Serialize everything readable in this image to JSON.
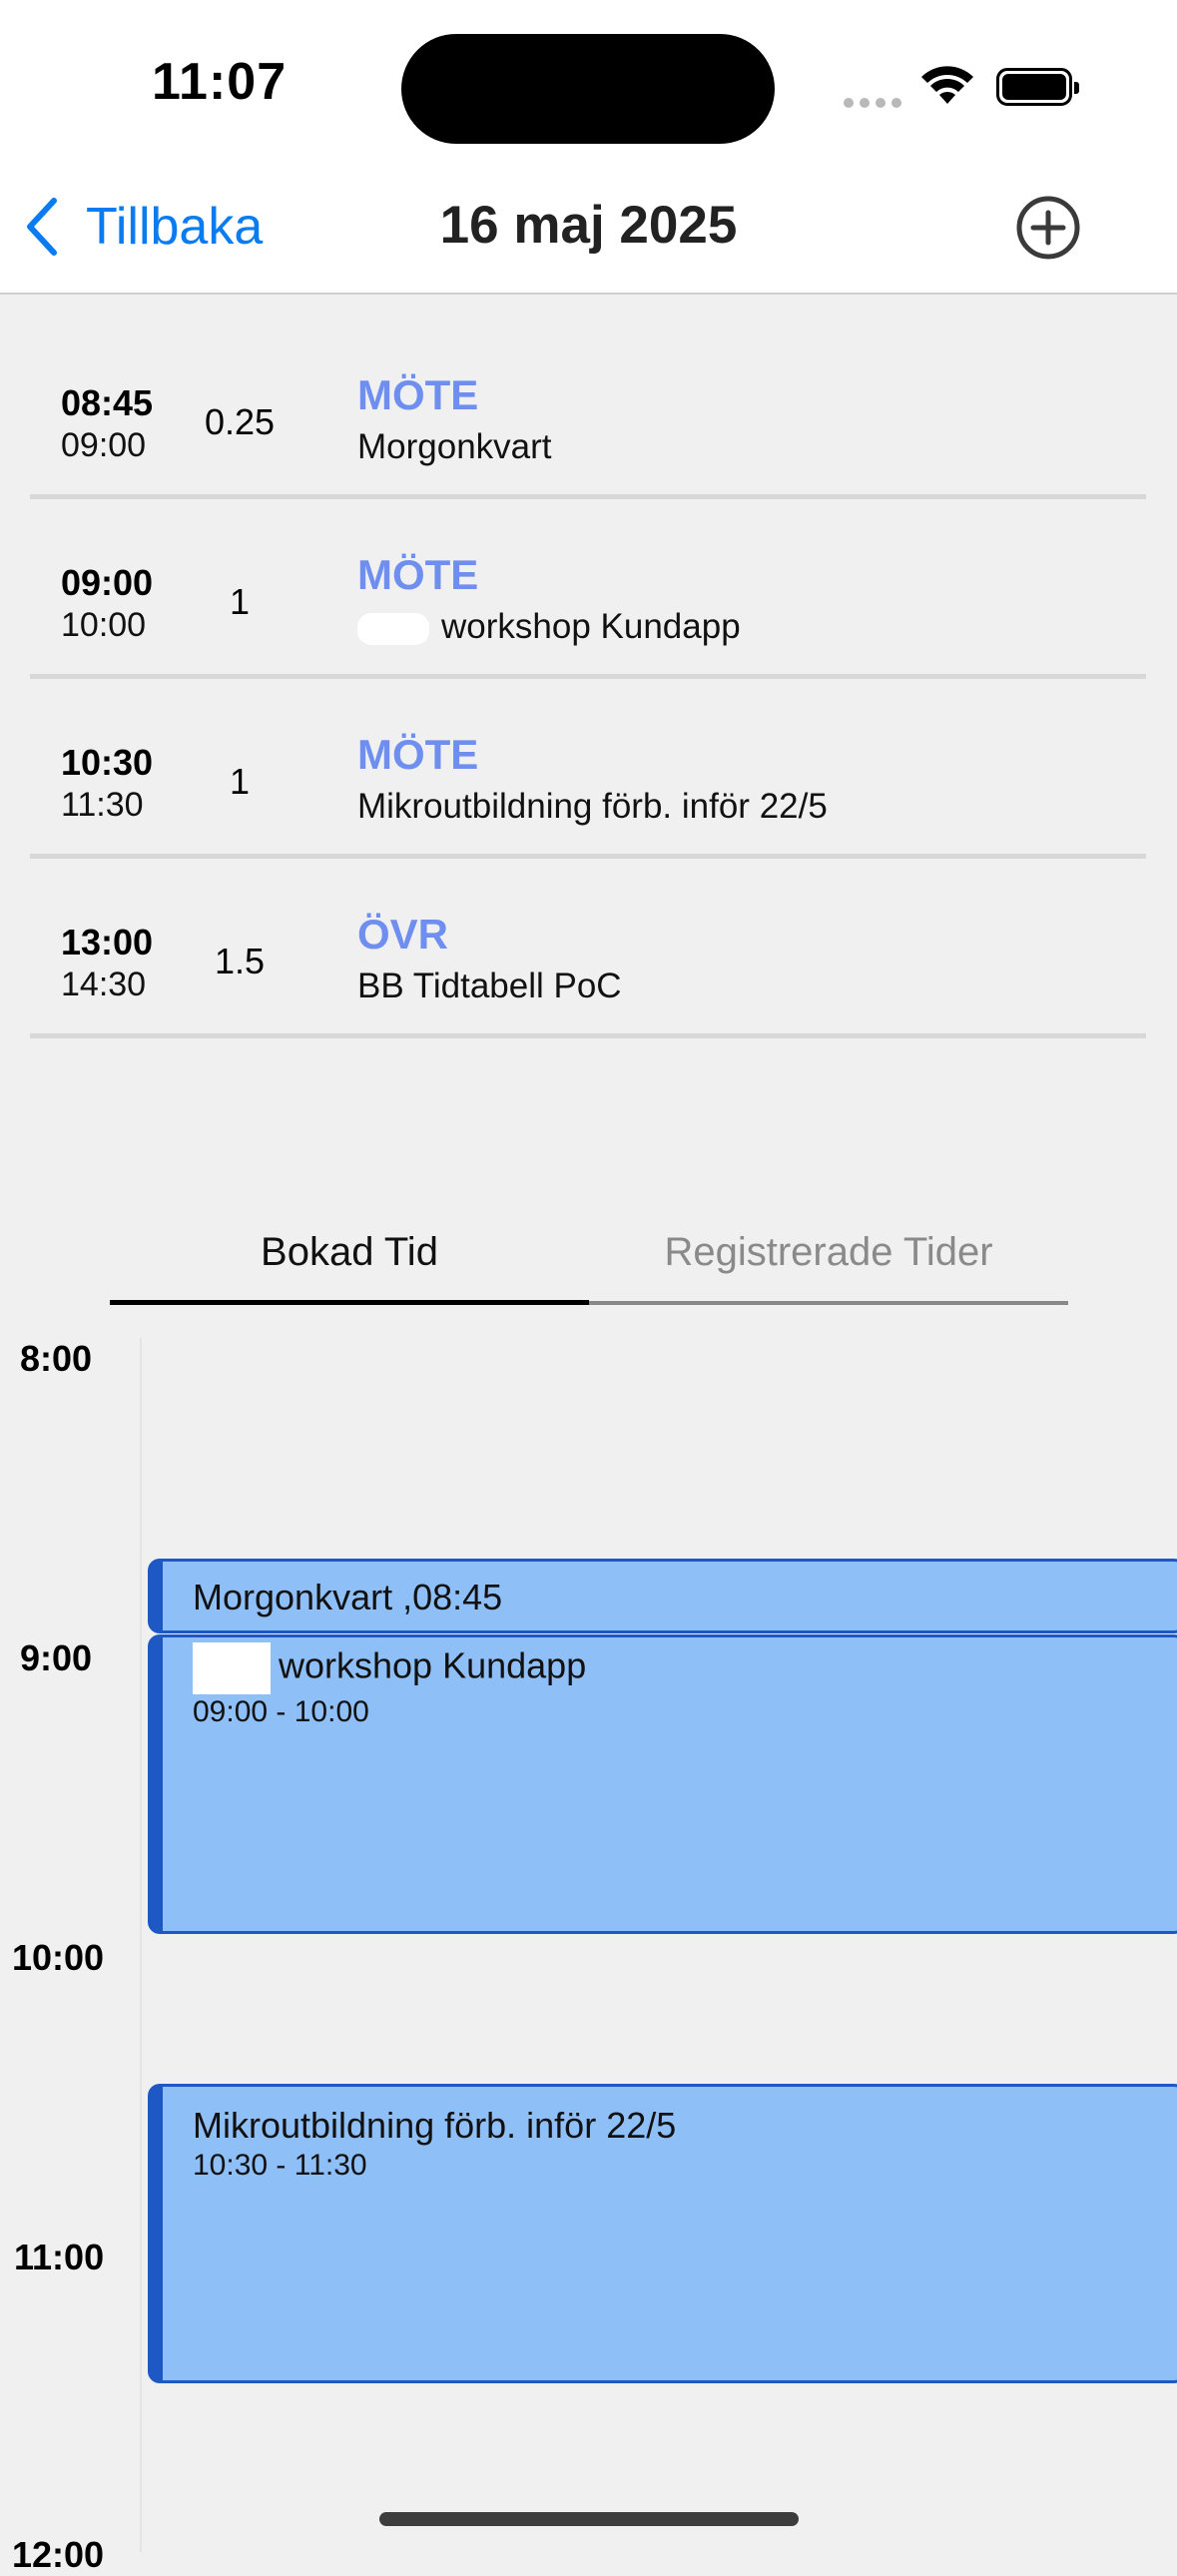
{
  "status_bar": {
    "time": "11:07"
  },
  "nav": {
    "back_label": "Tillbaka",
    "title": "16 maj 2025"
  },
  "entries": [
    {
      "start": "08:45",
      "end": "09:00",
      "hours": "0.25",
      "type": "MÖTE",
      "description": "Morgonkvart"
    },
    {
      "start": "09:00",
      "end": "10:00",
      "hours": "1",
      "type": "MÖTE",
      "description": "workshop Kundapp"
    },
    {
      "start": "10:30",
      "end": "11:30",
      "hours": "1",
      "type": "MÖTE",
      "description": "Mikroutbildning förb. inför 22/5"
    },
    {
      "start": "13:00",
      "end": "14:30",
      "hours": "1.5",
      "type": "ÖVR",
      "description": "BB Tidtabell PoC"
    }
  ],
  "tabs": [
    {
      "label": "Bokad Tid",
      "active": true
    },
    {
      "label": "Registrerade Tider",
      "active": false
    }
  ],
  "timeline": {
    "hours": [
      "8:00",
      "9:00",
      "10:00",
      "11:00",
      "12:00"
    ],
    "events": [
      {
        "title": "Morgonkvart ,08:45",
        "time": ""
      },
      {
        "title": "workshop Kundapp",
        "time": "09:00 - 10:00"
      },
      {
        "title": "Mikroutbildning förb. inför 22/5",
        "time": "10:30 - 11:30"
      }
    ]
  },
  "colors": {
    "accent": "#0a7cf0",
    "type_label": "#6f8ff0",
    "event_fill": "#8ebff7",
    "event_border": "#1d58c4"
  }
}
